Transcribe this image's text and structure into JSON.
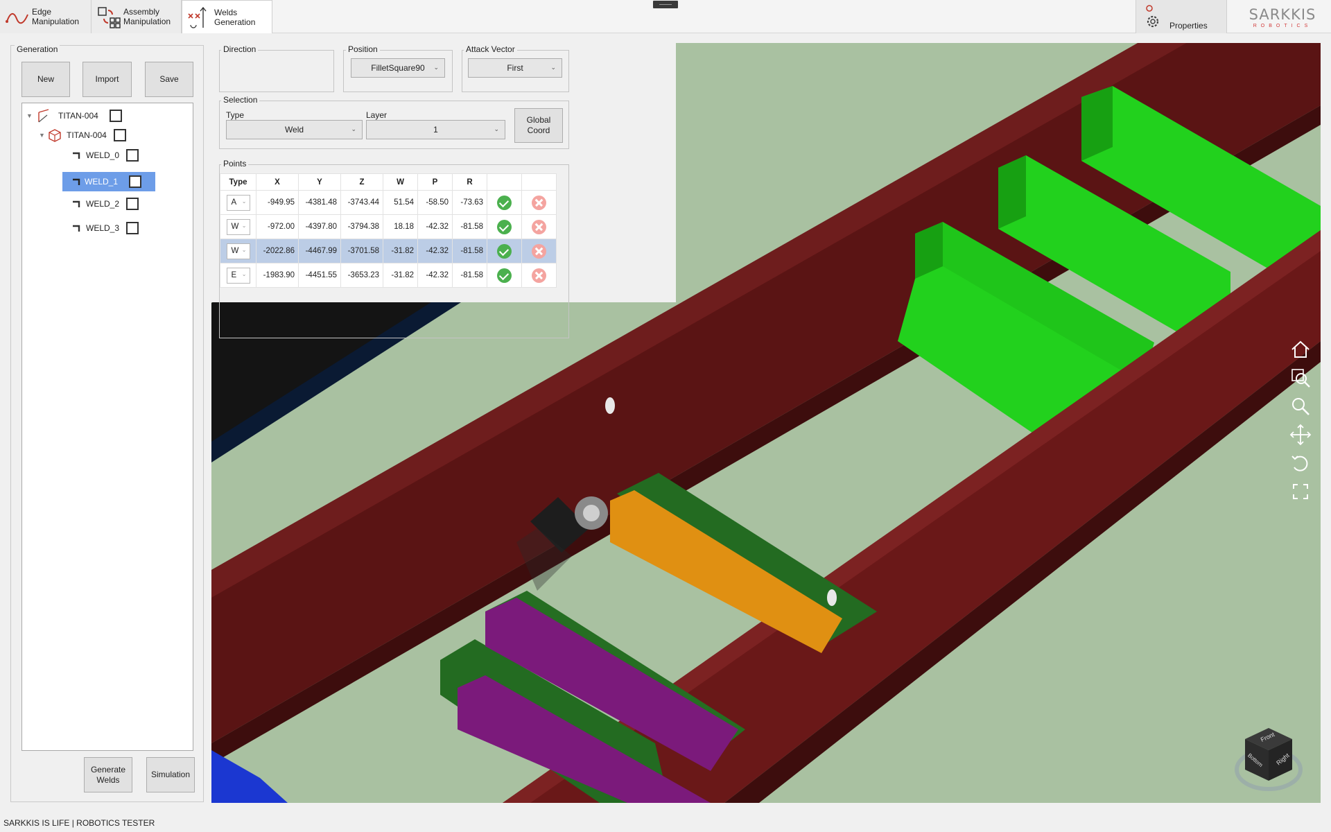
{
  "ribbon": {
    "tabs": [
      {
        "label": "Edge\nManipulation"
      },
      {
        "label": "Assembly\nManipulation"
      },
      {
        "label": "Welds\nGeneration"
      }
    ],
    "properties_label": "Properties",
    "logo_main": "SARKKIS",
    "logo_sub": "ROBOTICS"
  },
  "generation": {
    "title": "Generation",
    "new_label": "New",
    "import_label": "Import",
    "save_label": "Save",
    "generate_label": "Generate\nWelds",
    "simulation_label": "Simulation",
    "tree": [
      {
        "label": "TITAN-004",
        "level": 0
      },
      {
        "label": "TITAN-004",
        "level": 1
      },
      {
        "label": "WELD_0",
        "level": 2
      },
      {
        "label": "WELD_1",
        "level": 2,
        "selected": true
      },
      {
        "label": "WELD_2",
        "level": 2
      },
      {
        "label": "WELD_3",
        "level": 2
      }
    ]
  },
  "direction": {
    "title": "Direction"
  },
  "position": {
    "title": "Position",
    "value": "FilletSquare90"
  },
  "attack_vector": {
    "title": "Attack Vector",
    "value": "First"
  },
  "selection": {
    "title": "Selection",
    "type_label": "Type",
    "type_value": "Weld",
    "layer_label": "Layer",
    "layer_value": "1",
    "global_coord_label": "Global\nCoord"
  },
  "points": {
    "title": "Points",
    "headers": [
      "Type",
      "X",
      "Y",
      "Z",
      "W",
      "P",
      "R"
    ],
    "rows": [
      {
        "type": "A",
        "x": "-949.95",
        "y": "-4381.48",
        "z": "-3743.44",
        "w": "51.54",
        "p": "-58.50",
        "r": "-73.63"
      },
      {
        "type": "W",
        "x": "-972.00",
        "y": "-4397.80",
        "z": "-3794.38",
        "w": "18.18",
        "p": "-42.32",
        "r": "-81.58"
      },
      {
        "type": "W",
        "x": "-2022.86",
        "y": "-4467.99",
        "z": "-3701.58",
        "w": "-31.82",
        "p": "-42.32",
        "r": "-81.58",
        "highlighted": true
      },
      {
        "type": "E",
        "x": "-1983.90",
        "y": "-4451.55",
        "z": "-3653.23",
        "w": "-31.82",
        "p": "-42.32",
        "r": "-81.58"
      }
    ]
  },
  "viewcube": {
    "front": "Front",
    "right": "Right",
    "bottom": "Bottom"
  },
  "status_bar": "SARKKIS IS LIFE | ROBOTICS TESTER"
}
